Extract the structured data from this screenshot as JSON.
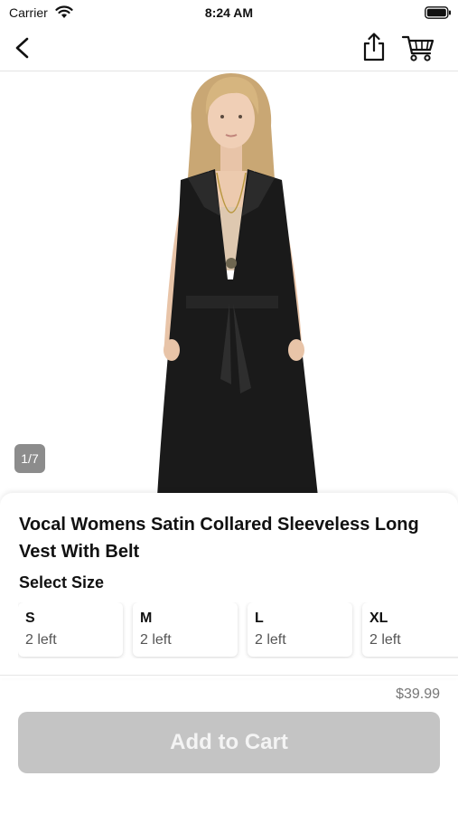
{
  "status_bar": {
    "carrier": "Carrier",
    "time": "8:24 AM"
  },
  "nav": {
    "back_icon": "chevron-left-icon",
    "share_icon": "share-icon",
    "cart_icon": "shopping-cart-icon"
  },
  "gallery": {
    "indicator": "1/7"
  },
  "product": {
    "title": "Vocal Womens Satin Collared Sleeveless Long Vest With Belt",
    "size_heading": "Select Size",
    "sizes": [
      {
        "label": "S",
        "stock": "2 left"
      },
      {
        "label": "M",
        "stock": "2 left"
      },
      {
        "label": "L",
        "stock": "2 left"
      },
      {
        "label": "XL",
        "stock": "2 left"
      }
    ],
    "price": "$39.99",
    "add_to_cart_label": "Add to Cart"
  },
  "colors": {
    "button_disabled": "#c4c4c4",
    "indicator_bg": "#8c8c8c",
    "garment": "#1a1a1a"
  }
}
